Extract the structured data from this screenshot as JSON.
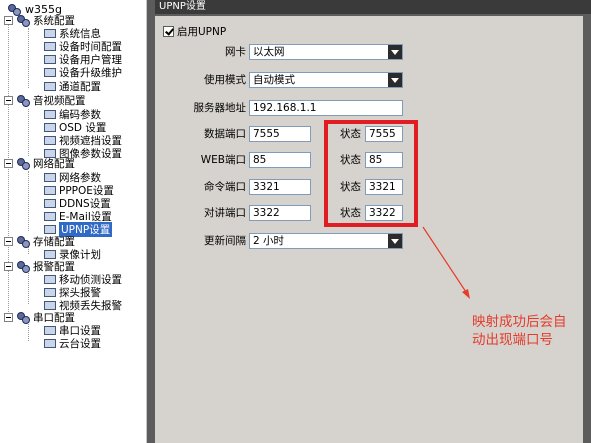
{
  "tree": {
    "root": "w355g",
    "groups": [
      {
        "label": "系统配置",
        "items": [
          "系统信息",
          "设备时间配置",
          "设备用户管理",
          "设备升级维护",
          "通道配置"
        ]
      },
      {
        "label": "音视频配置",
        "items": [
          "编码参数",
          "OSD 设置",
          "视频遮挡设置",
          "图像参数设置"
        ]
      },
      {
        "label": "网络配置",
        "items": [
          "网络参数",
          "PPPOE设置",
          "DDNS设置",
          "E-Mail设置",
          "UPNP设置"
        ]
      },
      {
        "label": "存储配置",
        "items": [
          "录像计划"
        ]
      },
      {
        "label": "报警配置",
        "items": [
          "移动侦测设置",
          "探头报警",
          "视频丢失报警"
        ]
      },
      {
        "label": "串口配置",
        "items": [
          "串口设置",
          "云台设置"
        ]
      }
    ],
    "selected": "UPNP设置"
  },
  "panel": {
    "title": "UPNP设置",
    "enable_label": "启用UPNP",
    "enable_checked": true,
    "nic_label": "网卡",
    "nic_value": "以太网",
    "mode_label": "使用模式",
    "mode_value": "自动模式",
    "server_label": "服务器地址",
    "server_value": "192.168.1.1",
    "ports": [
      {
        "label": "数据端口",
        "value": "7555",
        "status_label": "状态",
        "status_value": "7555"
      },
      {
        "label": "WEB端口",
        "value": "85",
        "status_label": "状态",
        "status_value": "85"
      },
      {
        "label": "命令端口",
        "value": "3321",
        "status_label": "状态",
        "status_value": "3321"
      },
      {
        "label": "对讲端口",
        "value": "3322",
        "status_label": "状态",
        "status_value": "3322"
      }
    ],
    "interval_label": "更新间隔",
    "interval_value": "2 小时"
  },
  "annotation": {
    "line1": "映射成功后会自",
    "line2": "动出现端口号",
    "color": "#e43b2b"
  }
}
